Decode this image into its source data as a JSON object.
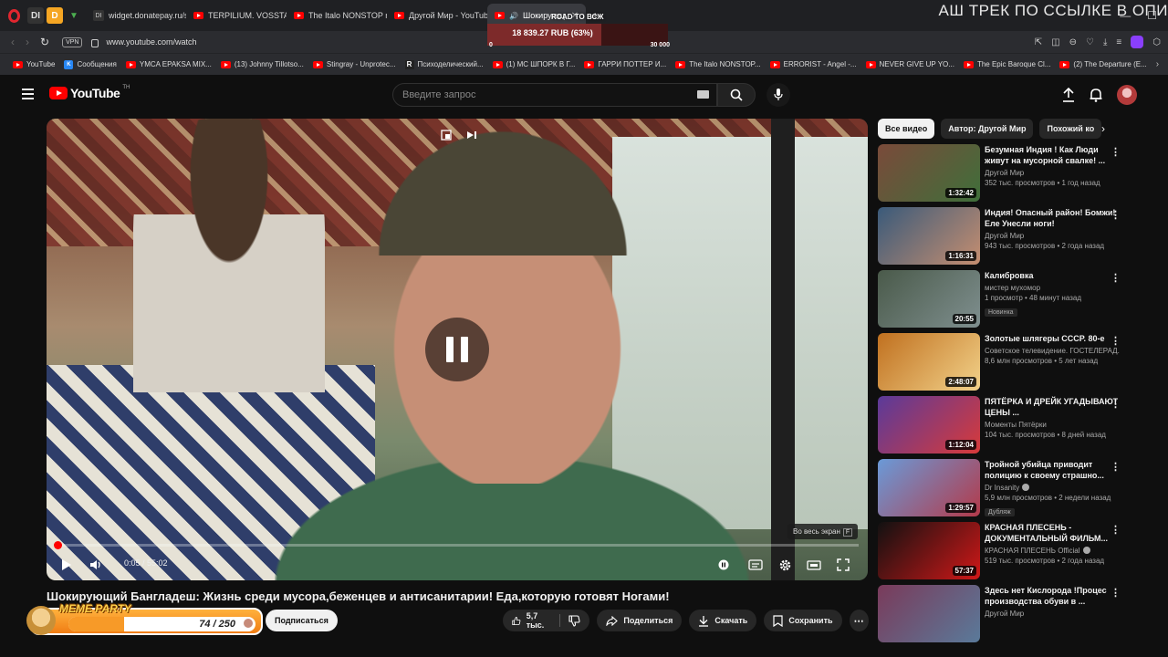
{
  "browser": {
    "tabs": [
      {
        "label": "widget.donatepay.ru/shov"
      },
      {
        "label": "TERPILIUM. VOSSTANOV"
      },
      {
        "label": "The Italo NONSTOP mega"
      },
      {
        "label": "Другой Мир - YouTube"
      },
      {
        "label": "Шокирующ"
      }
    ],
    "tab_icons": [
      "DI",
      "D",
      "▼"
    ],
    "url": "www.youtube.com/watch",
    "vpn_label": "VPN",
    "bookmarks": [
      "YouTube",
      "Сообщения",
      "YMCA EPAKSA MIX...",
      "(13) Johnny Tillotso...",
      "Stingray - Unprotec...",
      "Психоделический...",
      "(1) MC ШПОРК В Г...",
      "ГАРРИ ПОТТЕР И...",
      "The Italo NONSTOP...",
      "ERRORIST - Angel -...",
      "NEVER GIVE UP YO...",
      "The Epic Baroque Cl...",
      "(2) The Departure (E..."
    ]
  },
  "stream_overlay": {
    "goal_title": "ROAD TO ВСЖ",
    "goal_amount": "18 839.27 RUB (63%)",
    "goal_fraction": 0.63,
    "goal_min": "0",
    "goal_max": "30 000",
    "ticker": "АШ ТРЕК ПО ССЫЛКЕ В ОПИ",
    "meme_title": "MEME PARTY",
    "meme_count": "74 / 250",
    "meme_fraction": 0.296
  },
  "youtube": {
    "logo_text": "YouTube",
    "logo_region": "TH",
    "search_placeholder": "Введите запрос",
    "player": {
      "time": "0:05 / 55:02",
      "progress_fraction": 0.002,
      "tooltip": "Во весь экран",
      "tooltip_key": "F"
    },
    "video_title": "Шокирующий Бангладеш: Жизнь среди мусора,беженцев и антисанитарии! Еда,которую готовят Ногами!",
    "subscribe_label": "Подписаться",
    "like_count": "5,7 тыс.",
    "share_label": "Поделиться",
    "download_label": "Скачать",
    "save_label": "Сохранить",
    "chips": [
      "Все видео",
      "Автор: Другой Мир",
      "Похожий ко"
    ],
    "recommendations": [
      {
        "title": "Безумная Индия ! Как Люди живут на мусорной свалке! ...",
        "channel": "Другой Мир",
        "meta": "352 тыс. просмотров • 1 год назад",
        "duration": "1:32:42",
        "colors": [
          "#7a4a3a",
          "#3f6f3a"
        ]
      },
      {
        "title": "Индия! Опасный район! Бомжи! Еле Унесли ноги!",
        "channel": "Другой Мир",
        "meta": "943 тыс. просмотров • 2 года назад",
        "duration": "1:16:31",
        "colors": [
          "#3a5a7a",
          "#c58e70"
        ]
      },
      {
        "title": "Калибровка",
        "channel": "мистер мухомор",
        "meta": "1 просмотр • 48 минут назад",
        "duration": "20:55",
        "badge": "Новинка",
        "colors": [
          "#4a5a4a",
          "#7f8f8f"
        ]
      },
      {
        "title": "Золотые шлягеры СССР. 80-е",
        "channel": "Советское телевидение. ГОСТЕЛЕРАД...",
        "meta": "8,6 млн просмотров • 5 лет назад",
        "duration": "2:48:07",
        "colors": [
          "#c0701f",
          "#f2d28a"
        ]
      },
      {
        "title": "ПЯТЁРКА И ДРЕЙК УГАДЫВАЮТ ЦЕНЫ ...",
        "channel": "Моменты Пятёрки",
        "meta": "104 тыс. просмотров • 8 дней назад",
        "duration": "1:12:04",
        "colors": [
          "#5a3a9a",
          "#d83a3a"
        ]
      },
      {
        "title": "Тройной убийца приводит полицию к своему страшно...",
        "channel": "Dr Insanity",
        "meta": "5,9 млн просмотров • 2 недели назад",
        "duration": "1:29:57",
        "badge": "Дубляж",
        "colors": [
          "#6a9ad8",
          "#b33a4a"
        ]
      },
      {
        "title": "КРАСНАЯ ПЛЕСЕНЬ - ДОКУМЕНТАЛЬНЫЙ ФИЛЬМ...",
        "channel": "КРАСНАЯ ПЛЕСЕНЬ Official",
        "meta": "519 тыс. просмотров • 2 года назад",
        "duration": "57:37",
        "colors": [
          "#111111",
          "#d01818"
        ]
      },
      {
        "title": "Здесь нет Кислорода !Процес производства обуви в ...",
        "channel": "Другой Мир",
        "meta": "",
        "duration": "",
        "colors": [
          "#7a3a5a",
          "#5a7a9a"
        ]
      }
    ]
  }
}
